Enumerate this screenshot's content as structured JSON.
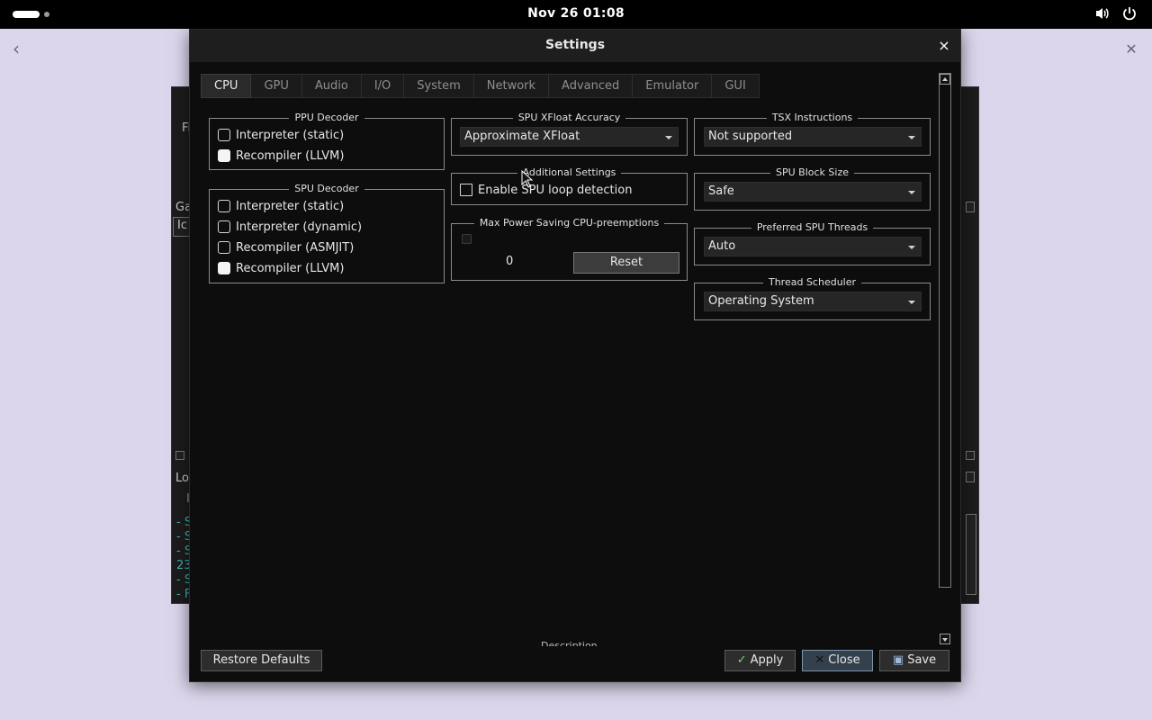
{
  "topbar": {
    "clock": "Nov 26  01:08",
    "icons": [
      "activities-indicator",
      "volume-icon",
      "power-icon"
    ]
  },
  "background_window": {
    "fragments": [
      "Fi",
      "Ga",
      "Ic",
      "Lo",
      "I"
    ],
    "log_lines": [
      "- S",
      "- S",
      "- S",
      "23",
      "- S",
      "- F"
    ]
  },
  "dialog": {
    "title": "Settings",
    "close_glyph": "×",
    "tabs": [
      "CPU",
      "GPU",
      "Audio",
      "I/O",
      "System",
      "Network",
      "Advanced",
      "Emulator",
      "GUI"
    ],
    "active_tab": "CPU",
    "ppu_decoder": {
      "title": "PPU Decoder",
      "options": [
        {
          "label": "Interpreter (static)",
          "checked": false
        },
        {
          "label": "Recompiler (LLVM)",
          "checked": true
        }
      ]
    },
    "spu_decoder": {
      "title": "SPU Decoder",
      "options": [
        {
          "label": "Interpreter (static)",
          "checked": false
        },
        {
          "label": "Interpreter (dynamic)",
          "checked": false
        },
        {
          "label": "Recompiler (ASMJIT)",
          "checked": false
        },
        {
          "label": "Recompiler (LLVM)",
          "checked": true
        }
      ]
    },
    "spu_xfloat": {
      "title": "SPU XFloat Accuracy",
      "value": "Approximate XFloat"
    },
    "additional_settings": {
      "title": "Additional Settings",
      "spu_loop_label": "Enable SPU loop detection",
      "spu_loop_checked": false
    },
    "max_power": {
      "title": "Max Power Saving CPU-preemptions",
      "value": "0",
      "reset_label": "Reset"
    },
    "tsx": {
      "title": "TSX Instructions",
      "value": "Not supported"
    },
    "spu_block_size": {
      "title": "SPU Block Size",
      "value": "Safe"
    },
    "preferred_spu_threads": {
      "title": "Preferred SPU Threads",
      "value": "Auto"
    },
    "thread_scheduler": {
      "title": "Thread Scheduler",
      "value": "Operating System"
    },
    "description_cut": "Description",
    "footer": {
      "restore_label": "Restore Defaults",
      "apply_label": "Apply",
      "close_label": "Close",
      "save_label": "Save"
    }
  }
}
